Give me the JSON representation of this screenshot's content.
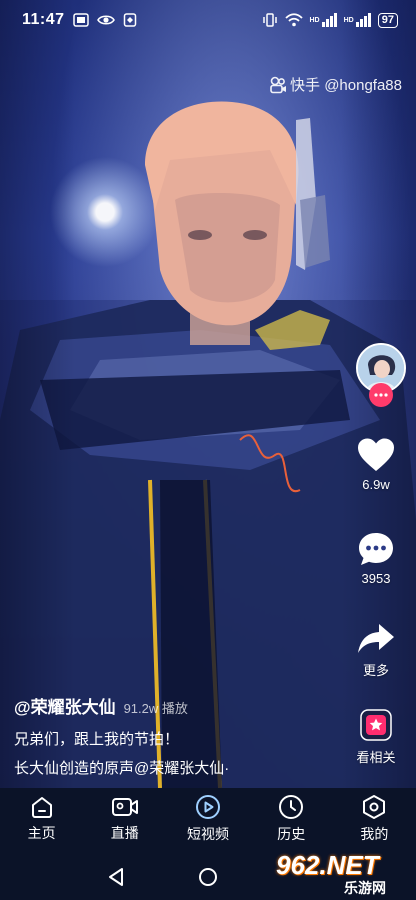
{
  "status_bar": {
    "time": "11:47",
    "battery": "97",
    "network_left": "HD",
    "network_right": "HD"
  },
  "watermark": {
    "text": "快手 @hongfa88"
  },
  "actions": {
    "like_count": "6.9w",
    "comment_count": "3953",
    "share_label": "更多",
    "related_label": "看相关"
  },
  "caption": {
    "author": "@荣耀张大仙",
    "plays": "91.2w 播放",
    "description": "兄弟们，跟上我的节拍！",
    "music": "长大仙创造的原声@荣耀张大仙·"
  },
  "bottom_nav": {
    "items": [
      {
        "label": "主页",
        "icon": "home-icon"
      },
      {
        "label": "直播",
        "icon": "live-camera-icon"
      },
      {
        "label": "短视频",
        "icon": "play-circle-icon"
      },
      {
        "label": "历史",
        "icon": "clock-icon"
      },
      {
        "label": "我的",
        "icon": "profile-hexagon-icon"
      }
    ]
  },
  "site_logo": {
    "main": "962.NET",
    "sub": "乐游网"
  },
  "colors": {
    "follow_accent": "#ff3b6b",
    "nav_background": "#0b1328",
    "related_icon": "#ff2d6f"
  }
}
